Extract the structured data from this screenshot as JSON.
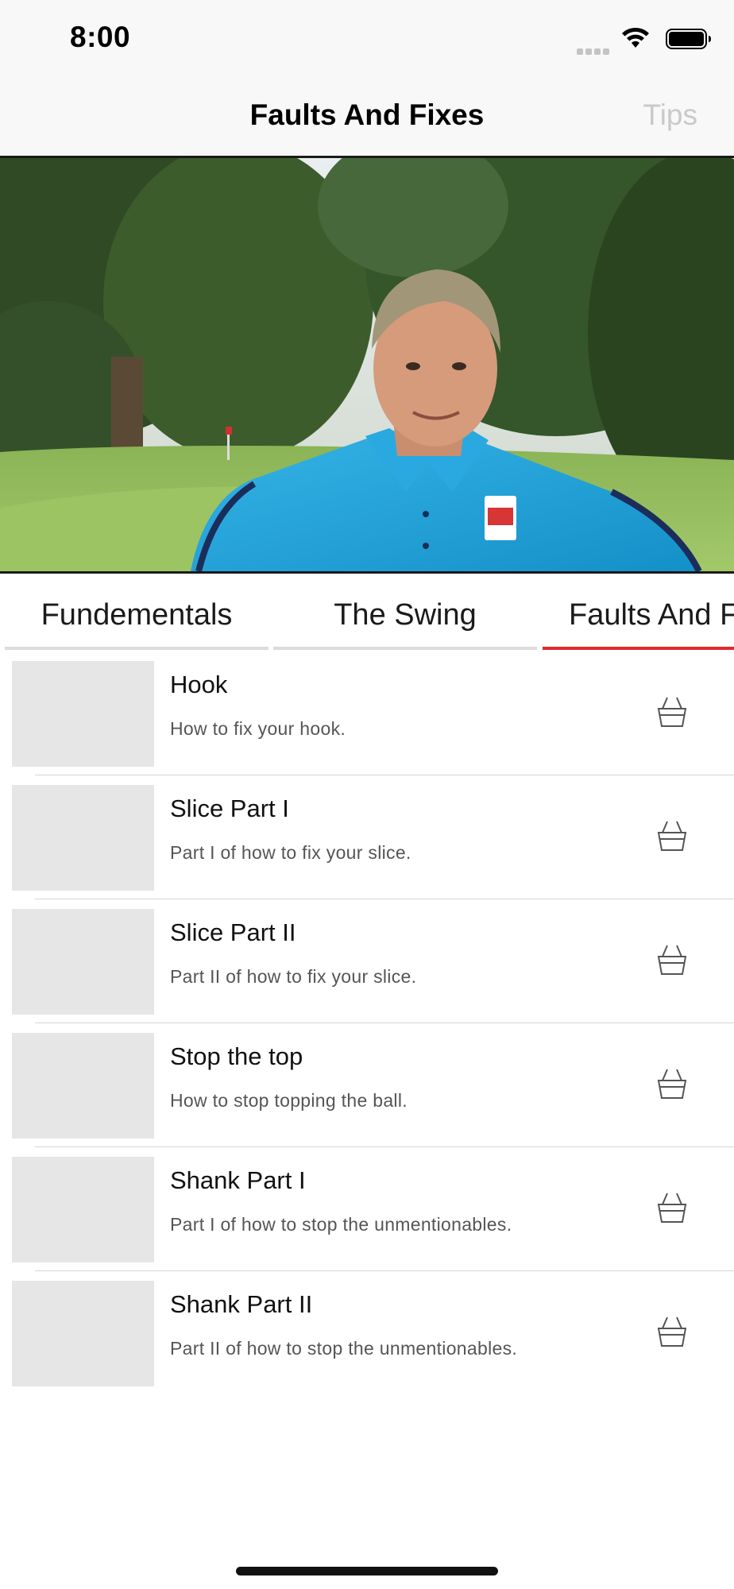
{
  "status": {
    "time": "8:00"
  },
  "nav": {
    "title": "Faults And Fixes",
    "tips_label": "Tips"
  },
  "hero": {
    "description": ""
  },
  "tabs": [
    {
      "label": "Fundementals",
      "active": false
    },
    {
      "label": "The Swing",
      "active": false
    },
    {
      "label": "Faults And Fixes",
      "active": true
    }
  ],
  "items": [
    {
      "title": "Hook",
      "subtitle": "How to fix your hook."
    },
    {
      "title": "Slice Part I",
      "subtitle": "Part I of how to fix your slice."
    },
    {
      "title": "Slice Part II",
      "subtitle": "Part II of how to fix your slice."
    },
    {
      "title": "Stop the top",
      "subtitle": "How to stop topping the ball."
    },
    {
      "title": "Shank Part I",
      "subtitle": "Part I of how to stop the unmentionables."
    },
    {
      "title": "Shank Part II",
      "subtitle": "Part II of how to stop the unmentionables."
    }
  ],
  "colors": {
    "accent": "#e02a2a",
    "shirt": "#1fa6dc"
  },
  "icons": {
    "basket": "basket-icon",
    "wifi": "wifi-icon",
    "battery": "battery-icon"
  }
}
